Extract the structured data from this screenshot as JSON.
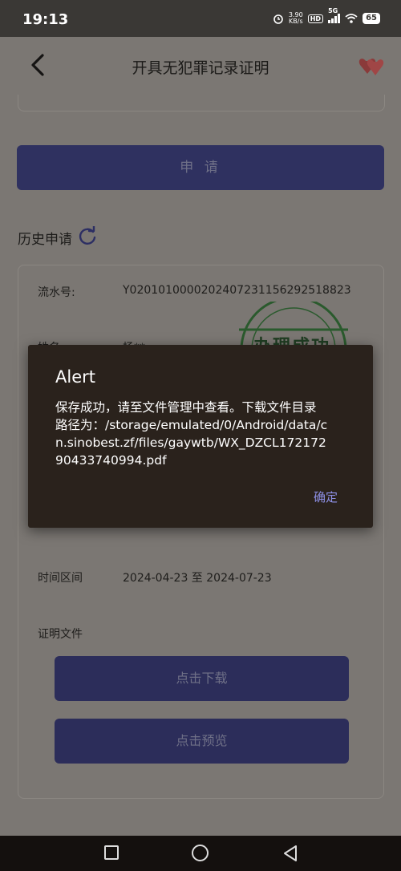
{
  "status_bar": {
    "time": "19:13",
    "net_speed_value": "3.90",
    "net_speed_unit": "KB/s",
    "hd_label": "HD",
    "network_label": "5G",
    "battery": "65"
  },
  "header": {
    "title": "开具无犯罪记录证明"
  },
  "apply_button_label": "申 请",
  "history": {
    "label": "历史申请"
  },
  "record": {
    "serial_label": "流水号:",
    "serial_value": "Y0201010000202407231156292518823",
    "name_label": "姓名",
    "name_value": "杨**",
    "stamp_text": "办理成功",
    "period_label": "时间区间",
    "period_value": "2024-04-23 至 2024-07-23",
    "file_label": "证明文件",
    "download_label": "点击下载",
    "preview_label": "点击预览"
  },
  "alert": {
    "title": "Alert",
    "message": "保存成功，请至文件管理中查看。下载文件目录路径为：/storage/emulated/0/Android/data/cn.sinobest.zf/files/gaywtb/WX_DZCL17217290433740994.pdf",
    "ok_label": "确定"
  },
  "colors": {
    "primary_button": "#2f3160",
    "dialog_bg": "#2a221c",
    "accent": "#8e90e6"
  }
}
